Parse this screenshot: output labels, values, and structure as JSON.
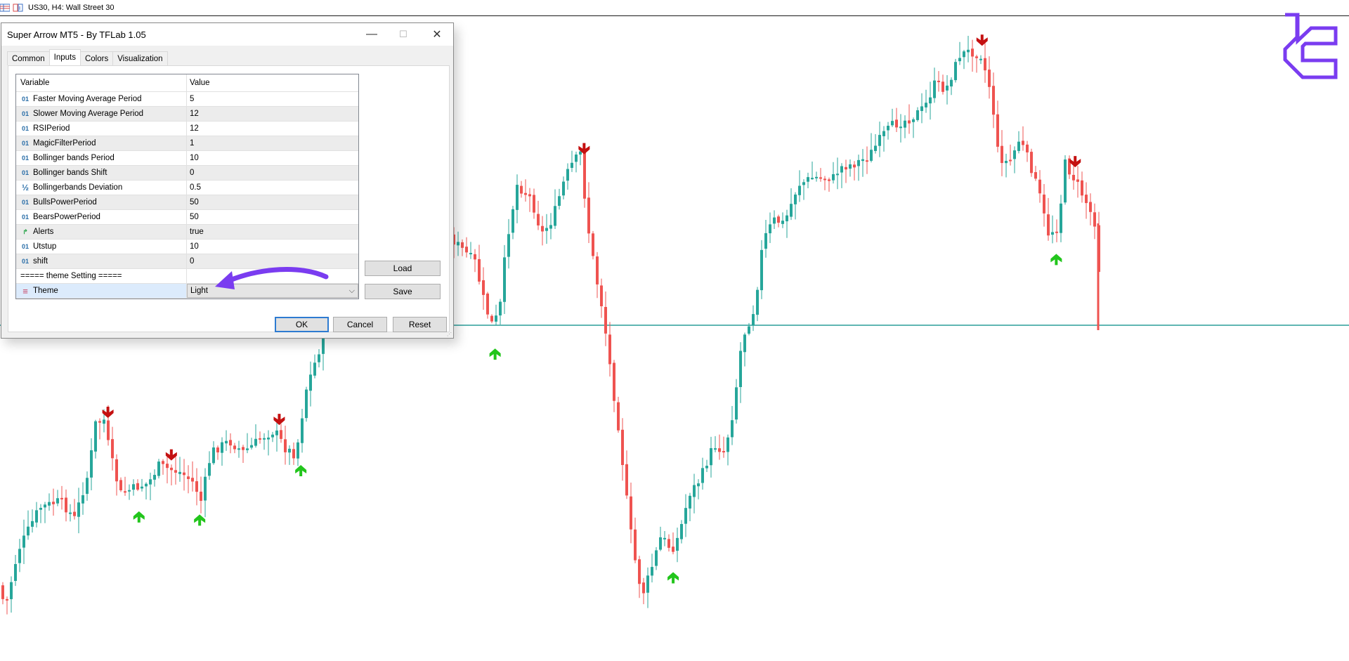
{
  "window": {
    "chart_title": "US30, H4:  Wall Street 30",
    "icons": [
      "list-icon",
      "chart-window-icon"
    ]
  },
  "dialog": {
    "title": "Super Arrow MT5 - By TFLab 1.05",
    "controls": {
      "minimize": "—",
      "maximize": "☐",
      "close": "✕"
    },
    "tabs": [
      {
        "label": "Common",
        "active": false
      },
      {
        "label": "Inputs",
        "active": true
      },
      {
        "label": "Colors",
        "active": false
      },
      {
        "label": "Visualization",
        "active": false
      }
    ],
    "grid": {
      "headers": {
        "variable": "Variable",
        "value": "Value"
      },
      "rows": [
        {
          "type": "int",
          "icon": "01",
          "name": "Faster Moving Average Period",
          "value": "5"
        },
        {
          "type": "int",
          "icon": "01",
          "name": "Slower Moving Average Period",
          "value": "12"
        },
        {
          "type": "int",
          "icon": "01",
          "name": "RSIPeriod",
          "value": "12"
        },
        {
          "type": "int",
          "icon": "01",
          "name": "MagicFilterPeriod",
          "value": "1"
        },
        {
          "type": "int",
          "icon": "01",
          "name": "Bollinger bands Period",
          "value": "10"
        },
        {
          "type": "int",
          "icon": "01",
          "name": "Bollinger bands Shift",
          "value": "0"
        },
        {
          "type": "double",
          "icon": "½",
          "name": "Bollingerbands Deviation",
          "value": "0.5"
        },
        {
          "type": "int",
          "icon": "01",
          "name": "BullsPowerPeriod",
          "value": "50"
        },
        {
          "type": "int",
          "icon": "01",
          "name": "BearsPowerPeriod",
          "value": "50"
        },
        {
          "type": "bool",
          "icon": "↱",
          "name": "Alerts",
          "value": "true"
        },
        {
          "type": "int",
          "icon": "01",
          "name": "Utstup",
          "value": "10"
        },
        {
          "type": "int",
          "icon": "01",
          "name": "shift",
          "value": "0"
        },
        {
          "type": "separator",
          "icon": "",
          "name": "===== theme Setting =====",
          "value": ""
        },
        {
          "type": "enum",
          "icon": "≡",
          "name": "Theme",
          "value": "Light",
          "selected": true
        }
      ]
    },
    "buttons": {
      "load": "Load",
      "save": "Save",
      "ok": "OK",
      "cancel": "Cancel",
      "reset": "Reset"
    }
  },
  "colors": {
    "bull": "#26a69a",
    "bear": "#ef5350",
    "up_arrow": "#22c51c",
    "down_arrow": "#c41010",
    "hline": "#2a9d9a",
    "annotation_arrow": "#7a3cf0",
    "logo": "#7a3cf0",
    "dialog_bg": "#f0f0f0"
  },
  "chart": {
    "symbol": "US30",
    "timeframe": "H4",
    "description": "Wall Street 30",
    "style": "candlesticks",
    "signals": [
      {
        "dir": "down",
        "pos": 0.08
      },
      {
        "dir": "up",
        "pos": 0.103
      },
      {
        "dir": "down",
        "pos": 0.127
      },
      {
        "dir": "up",
        "pos": 0.148
      },
      {
        "dir": "down",
        "pos": 0.207
      },
      {
        "dir": "up",
        "pos": 0.223
      },
      {
        "dir": "up",
        "pos": 0.367
      },
      {
        "dir": "down",
        "pos": 0.433
      },
      {
        "dir": "up",
        "pos": 0.499
      },
      {
        "dir": "down",
        "pos": 0.728
      },
      {
        "dir": "up",
        "pos": 0.783
      },
      {
        "dir": "down",
        "pos": 0.797
      }
    ]
  },
  "annotation": {
    "type": "arrow",
    "points_to": "Theme value"
  }
}
